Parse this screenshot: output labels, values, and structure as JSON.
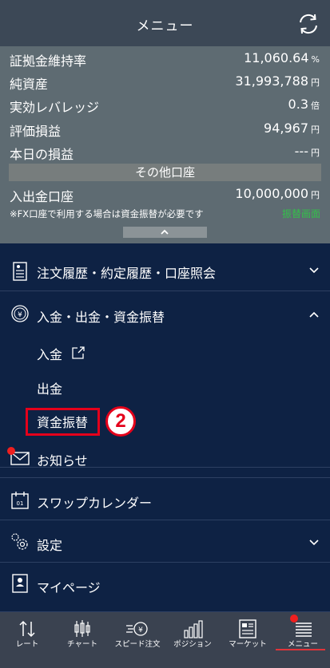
{
  "header": {
    "title": "メニュー",
    "refresh_icon": "refresh-icon"
  },
  "summary": {
    "rows": [
      {
        "label": "証拠金維持率",
        "value": "11,060.64",
        "unit": "%"
      },
      {
        "label": "純資産",
        "value": "31,993,788",
        "unit": "円"
      },
      {
        "label": "実効レバレッジ",
        "value": "0.3",
        "unit": "倍"
      },
      {
        "label": "評価損益",
        "value": "94,967",
        "unit": "円"
      },
      {
        "label": "本日の損益",
        "value": "---",
        "unit": "円"
      }
    ],
    "other_accounts": "その他口座",
    "deposit_account": {
      "label": "入出金口座",
      "value": "10,000,000",
      "unit": "円"
    },
    "note": "※FX口座で利用する場合は資金振替が必要です",
    "transfer_link": "振替画面",
    "link_color": "#33c14a"
  },
  "menu": {
    "history": "注文履歴・約定履歴・口座照会",
    "funds": "入金・出金・資金振替",
    "deposit": "入金",
    "withdraw": "出金",
    "transfer": "資金振替",
    "notices": "お知らせ",
    "swap_calendar": "スワップカレンダー",
    "settings": "設定",
    "mypage": "マイページ"
  },
  "annotation": {
    "step_number": "2",
    "color": "#e4001b"
  },
  "tabs": [
    {
      "label": "レート",
      "icon": "rate-arrows-icon"
    },
    {
      "label": "チャート",
      "icon": "candlestick-chart-icon"
    },
    {
      "label": "スピード注文",
      "icon": "speed-order-icon"
    },
    {
      "label": "ポジション",
      "icon": "position-bars-icon"
    },
    {
      "label": "マーケット",
      "icon": "market-news-icon"
    },
    {
      "label": "メニュー",
      "icon": "menu-list-icon",
      "active": true
    }
  ]
}
